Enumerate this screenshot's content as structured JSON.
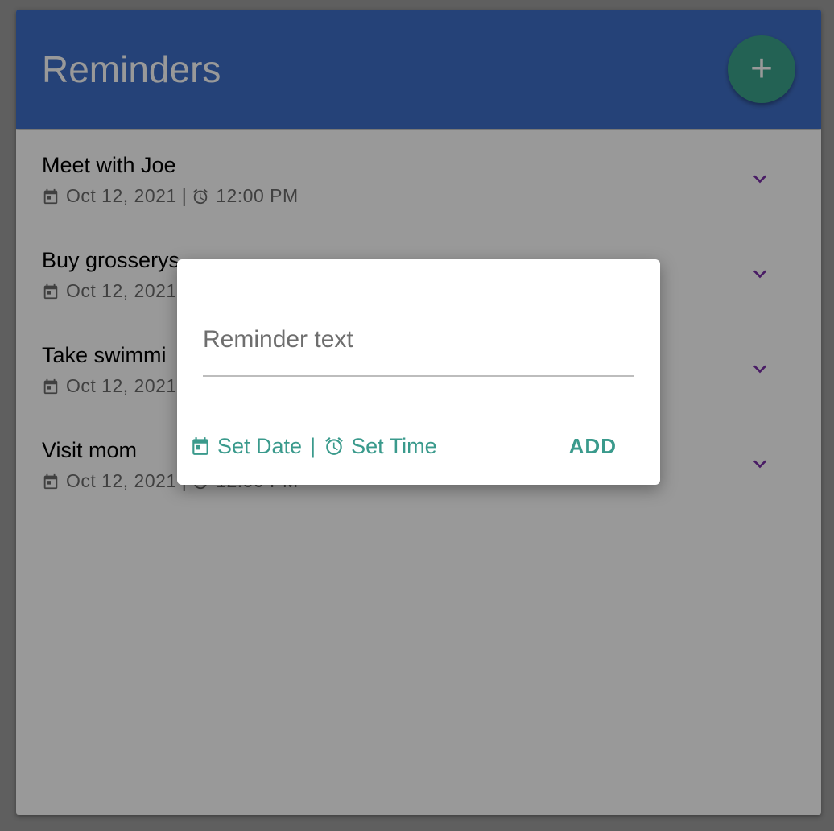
{
  "header": {
    "title": "Reminders",
    "add_icon": "plus-icon"
  },
  "reminders": [
    {
      "title": "Meet with Joe",
      "date": "Oct 12, 2021",
      "time": "12:00 PM"
    },
    {
      "title": "Buy grosserys",
      "date": "Oct 12, 2021",
      "time": ""
    },
    {
      "title": "Take swimmi",
      "date": "Oct 12, 2021",
      "time": ""
    },
    {
      "title": "Visit mom",
      "date": "Oct 12, 2021",
      "time": "12:00 PM"
    }
  ],
  "meta_separator": "|",
  "dialog": {
    "input_placeholder": "Reminder text",
    "set_date_label": "Set Date",
    "separator": "|",
    "set_time_label": "Set Time",
    "add_label": "ADD"
  },
  "colors": {
    "header": "#3f6fc8",
    "fab": "#3ba48c",
    "chevron": "#7b2fa8",
    "dialog_accent": "#3a9a8c"
  }
}
